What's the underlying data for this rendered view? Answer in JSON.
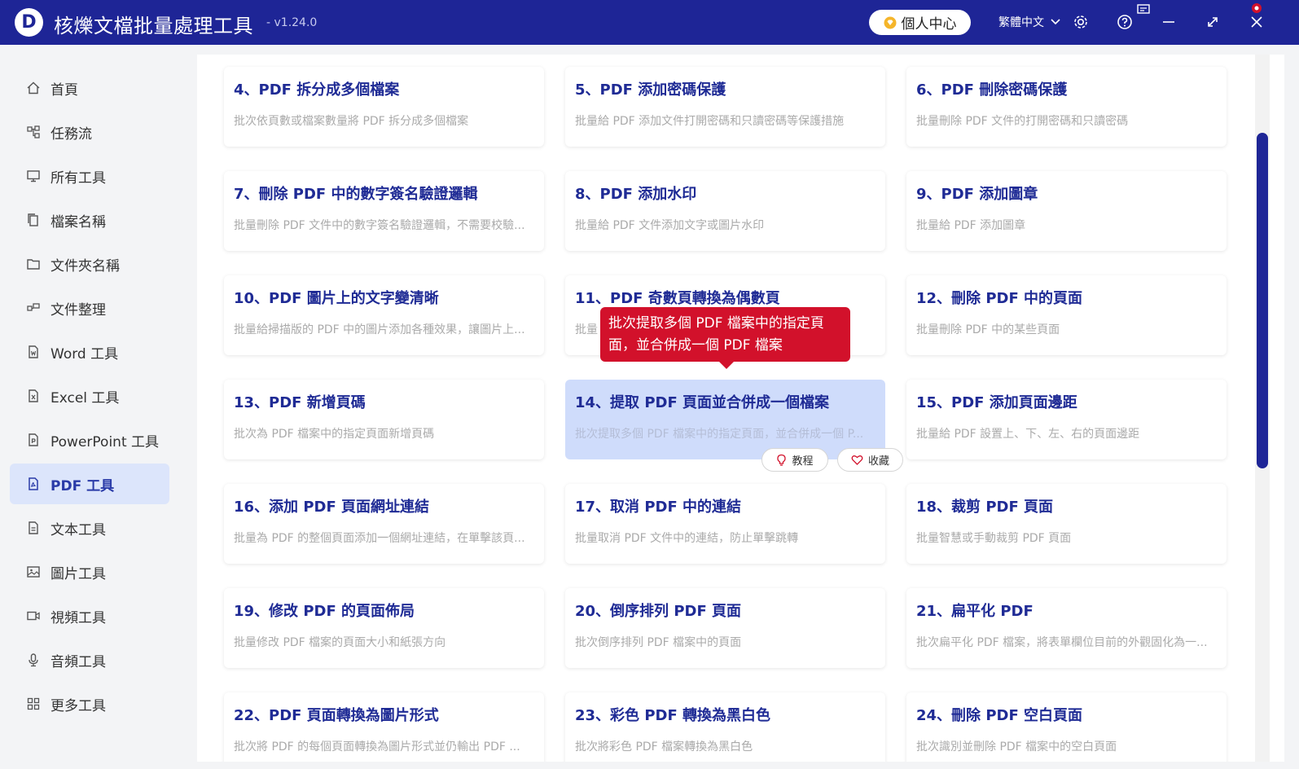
{
  "app": {
    "logo_letter": "D",
    "title": "核爍文檔批量處理工具",
    "version": "- v1.24.0",
    "user_center": "個人中心",
    "language": "繁體中文",
    "brand_color": "#1e2596",
    "tooltip_color": "#d2112b"
  },
  "sidebar": {
    "items": [
      {
        "label": "首頁",
        "icon": "home-icon"
      },
      {
        "label": "任務流",
        "icon": "workflow-icon"
      },
      {
        "label": "所有工具",
        "icon": "monitor-icon"
      },
      {
        "label": "檔案名稱",
        "icon": "file-copy-icon"
      },
      {
        "label": "文件夾名稱",
        "icon": "folder-icon"
      },
      {
        "label": "文件整理",
        "icon": "organize-icon"
      },
      {
        "label": "Word 工具",
        "icon": "word-file-icon"
      },
      {
        "label": "Excel 工具",
        "icon": "excel-file-icon"
      },
      {
        "label": "PowerPoint 工具",
        "icon": "ppt-file-icon"
      },
      {
        "label": "PDF 工具",
        "icon": "pdf-file-icon",
        "active": true
      },
      {
        "label": "文本工具",
        "icon": "text-file-icon"
      },
      {
        "label": "圖片工具",
        "icon": "image-icon"
      },
      {
        "label": "視頻工具",
        "icon": "video-icon"
      },
      {
        "label": "音頻工具",
        "icon": "microphone-icon"
      },
      {
        "label": "更多工具",
        "icon": "grid-icon"
      }
    ]
  },
  "cards": [
    {
      "title": "4、PDF 拆分成多個檔案",
      "desc": "批次依頁數或檔案數量將 PDF 拆分成多個檔案"
    },
    {
      "title": "5、PDF 添加密碼保護",
      "desc": "批量給 PDF 添加文件打開密碼和只讀密碼等保護措施"
    },
    {
      "title": "6、PDF 刪除密碼保護",
      "desc": "批量刪除 PDF 文件的打開密碼和只讀密碼"
    },
    {
      "title": "7、刪除 PDF 中的數字簽名驗證邏輯",
      "desc": "批量刪除 PDF 文件中的數字簽名驗證邏輯，不需要校驗..."
    },
    {
      "title": "8、PDF 添加水印",
      "desc": "批量給 PDF 文件添加文字或圖片水印"
    },
    {
      "title": "9、PDF 添加圖章",
      "desc": "批量給 PDF 添加圖章"
    },
    {
      "title": "10、PDF 圖片上的文字變清晰",
      "desc": "批量給掃描版的 PDF 中的圖片添加各種效果，讓圖片上..."
    },
    {
      "title": "11、PDF 奇數頁轉換為偶數頁",
      "desc": "批量"
    },
    {
      "title": "12、刪除 PDF 中的頁面",
      "desc": "批量刪除 PDF 中的某些頁面"
    },
    {
      "title": "13、PDF 新增頁碼",
      "desc": "批次為 PDF 檔案中的指定頁面新增頁碼"
    },
    {
      "title": "14、提取 PDF 頁面並合併成一個檔案",
      "desc": "批次提取多個 PDF 檔案中的指定頁面，並合併成一個 P..."
    },
    {
      "title": "15、PDF 添加頁面邊距",
      "desc": "批量給 PDF 設置上、下、左、右的頁面邊距"
    },
    {
      "title": "16、添加 PDF 頁面網址連結",
      "desc": "批量為 PDF 的整個頁面添加一個網址連結，在單擊該頁..."
    },
    {
      "title": "17、取消 PDF 中的連結",
      "desc": "批量取消 PDF 文件中的連結，防止單擊跳轉"
    },
    {
      "title": "18、裁剪 PDF 頁面",
      "desc": "批量智慧或手動裁剪 PDF 頁面"
    },
    {
      "title": "19、修改 PDF 的頁面佈局",
      "desc": "批量修改 PDF 檔案的頁面大小和紙張方向"
    },
    {
      "title": "20、倒序排列 PDF 頁面",
      "desc": "批次倒序排列 PDF 檔案中的頁面"
    },
    {
      "title": "21、扁平化 PDF",
      "desc": "批次扁平化 PDF 檔案，將表單欄位目前的外觀固化為一..."
    },
    {
      "title": "22、PDF 頁面轉換為圖片形式",
      "desc": "批次將 PDF 的每個頁面轉換為圖片形式並仍輸出 PDF ..."
    },
    {
      "title": "23、彩色 PDF 轉換為黑白色",
      "desc": "批次將彩色 PDF 檔案轉換為黑白色"
    },
    {
      "title": "24、刪除 PDF 空白頁面",
      "desc": "批次識別並刪除 PDF 檔案中的空白頁面"
    }
  ],
  "highlighted_card": 10,
  "card_actions": {
    "tutorial": "教程",
    "favorite": "收藏"
  },
  "tooltip": {
    "line1": "批次提取多個 PDF 檔案中的指定頁",
    "line2": "面，並合併成一個 PDF 檔案"
  }
}
